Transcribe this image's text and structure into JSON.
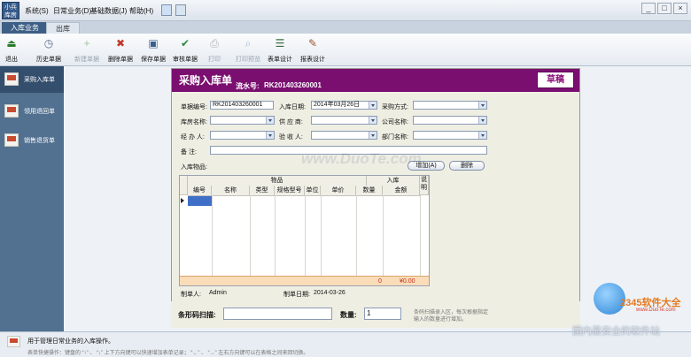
{
  "app": {
    "logo": "小兵库房"
  },
  "menu": [
    "系统(S)",
    "日常业务(D)",
    "基础数据(J)",
    "帮助(H)"
  ],
  "window_controls": [
    "_",
    "□",
    "×"
  ],
  "tabs": [
    {
      "label": "入库业务"
    },
    {
      "label": "出库"
    }
  ],
  "toolbar": [
    {
      "label": "退出",
      "icon": "exit-icon",
      "disabled": false
    },
    {
      "label": "历史单据",
      "icon": "history-icon",
      "disabled": false
    },
    {
      "label": "新建单据",
      "icon": "new-doc-icon",
      "disabled": true
    },
    {
      "label": "删除单据",
      "icon": "delete-icon",
      "disabled": false
    },
    {
      "label": "保存单据",
      "icon": "save-icon",
      "disabled": false
    },
    {
      "label": "审核单据",
      "icon": "approve-icon",
      "disabled": false
    },
    {
      "label": "打印",
      "icon": "printer-icon",
      "disabled": true
    },
    {
      "label": "打印预览",
      "icon": "print-preview-icon",
      "disabled": true
    },
    {
      "label": "表单设计",
      "icon": "form-design-icon",
      "disabled": false
    },
    {
      "label": "报表设计",
      "icon": "report-design-icon",
      "disabled": false
    }
  ],
  "sidebar": [
    {
      "label": "采购入库单",
      "active": true
    },
    {
      "label": "领用退回单",
      "active": false
    },
    {
      "label": "销售退货单",
      "active": false
    }
  ],
  "doc": {
    "title": "采购入库单",
    "serial_label": "流水号:",
    "serial": "RK201403260001",
    "status": "草稿",
    "fields": {
      "doc_no_label": "单据编号:",
      "doc_no": "RK201403260001",
      "date_label": "入库日期:",
      "date": "2014年03月26日",
      "purchase_label": "采购方式:",
      "purchase": "",
      "warehouse_label": "库房名称:",
      "warehouse": "",
      "supplier_label": "供 应 商:",
      "supplier": "",
      "company_label": "公司名称:",
      "company": "",
      "handler_label": "经 办 人:",
      "handler": "",
      "receiver_label": "验 收 人:",
      "receiver": "",
      "dept_label": "部门名称:",
      "dept": "",
      "note_label": "备    注:",
      "note": ""
    },
    "items_label": "入库物品:",
    "add_button": "增加(A)",
    "delete_button": "删除",
    "grid": {
      "group_goods": "物品",
      "group_in": "入库",
      "side_header": "说明",
      "columns": [
        "编号",
        "名称",
        "类型",
        "规格型号",
        "单位",
        "单价",
        "数量",
        "金额"
      ],
      "totals": {
        "quantity": "0",
        "amount": "¥0.00"
      }
    },
    "maker_label": "制单人:",
    "maker": "Admin",
    "make_date_label": "制单日期:",
    "make_date": "2014-03-26",
    "barcode_label": "条形码扫描:",
    "barcode": "",
    "qty_label": "数量:",
    "qty": "1",
    "barcode_hint_1": "条码扫描录入区，每次根据指定",
    "barcode_hint_2": "输入的数量进行增加。"
  },
  "footer": {
    "title": "用于管理日常业务的入库操作。",
    "hint": "表单快捷操作：键盘的 “↑” 、 “↓” 上下方向键可以快速增加表单记录； “←” 、 “→” 左右方向键可以在表格之间来回切换。"
  },
  "watermark": {
    "center": "www.DuoTe.com",
    "brand": "2345软件大全",
    "brand_url": "www.DuoTe.com",
    "slogan": "国内最安全的软件站"
  }
}
